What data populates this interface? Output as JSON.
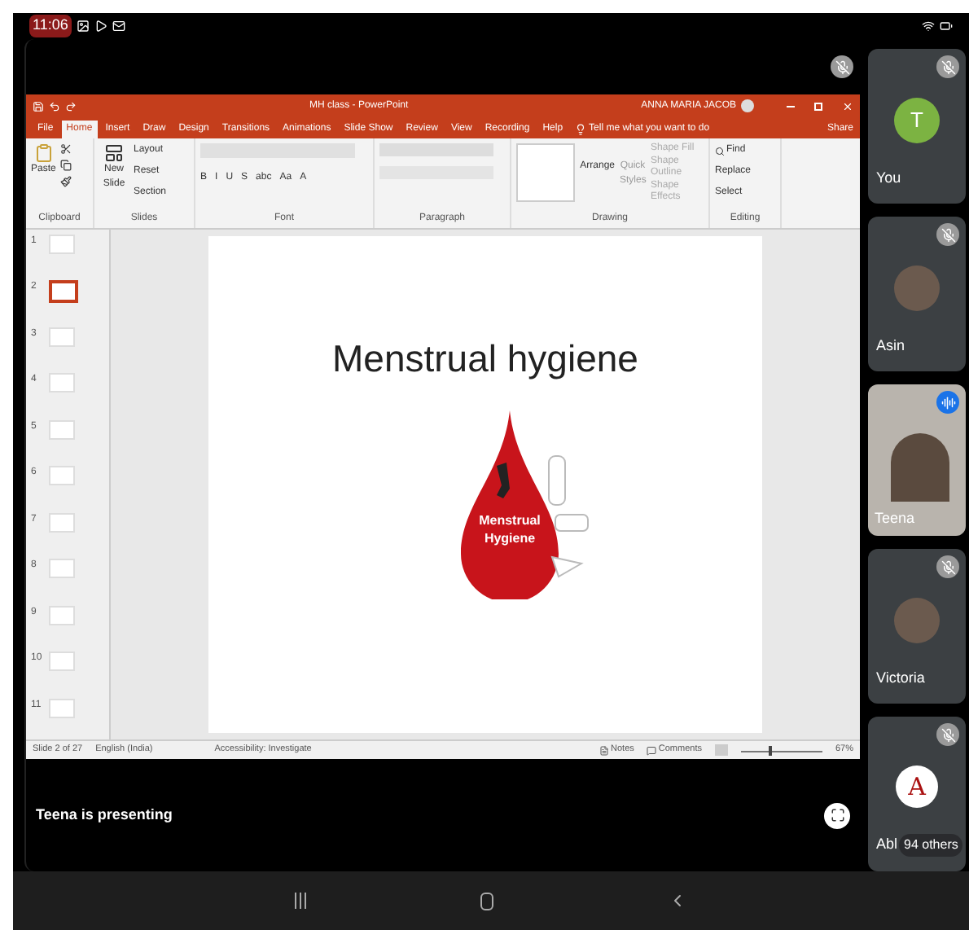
{
  "status_bar": {
    "time": "11:06"
  },
  "powerpoint": {
    "title": "MH class - PowerPoint",
    "user": "ANNA MARIA JACOB",
    "tabs": [
      {
        "label": "File",
        "selected": false
      },
      {
        "label": "Home",
        "selected": true
      },
      {
        "label": "Insert",
        "selected": false
      },
      {
        "label": "Draw",
        "selected": false
      },
      {
        "label": "Design",
        "selected": false
      },
      {
        "label": "Transitions",
        "selected": false
      },
      {
        "label": "Animations",
        "selected": false
      },
      {
        "label": "Slide Show",
        "selected": false
      },
      {
        "label": "Review",
        "selected": false
      },
      {
        "label": "View",
        "selected": false
      },
      {
        "label": "Recording",
        "selected": false
      },
      {
        "label": "Help",
        "selected": false
      }
    ],
    "tell_me": "Tell me what you want to do",
    "share": "Share",
    "ribbon": {
      "clipboard": {
        "paste": "Paste",
        "label": "Clipboard"
      },
      "slides": {
        "new_slide": "New Slide",
        "layout": "Layout",
        "reset": "Reset",
        "section": "Section",
        "label": "Slides"
      },
      "font": {
        "buttons": [
          "B",
          "I",
          "U",
          "S",
          "abc",
          "Aa",
          "A"
        ],
        "label": "Font"
      },
      "paragraph": {
        "label": "Paragraph"
      },
      "drawing": {
        "arrange": "Arrange",
        "quick_styles": "Quick Styles",
        "shape_fill": "Shape Fill",
        "shape_outline": "Shape Outline",
        "shape_effects": "Shape Effects",
        "label": "Drawing"
      },
      "editing": {
        "find": "Find",
        "replace": "Replace",
        "select": "Select",
        "label": "Editing"
      }
    },
    "slides": [
      {
        "number": "1",
        "selected": false
      },
      {
        "number": "2",
        "selected": true
      },
      {
        "number": "3",
        "selected": false
      },
      {
        "number": "4",
        "selected": false
      },
      {
        "number": "5",
        "selected": false
      },
      {
        "number": "6",
        "selected": false
      },
      {
        "number": "7",
        "selected": false
      },
      {
        "number": "8",
        "selected": false
      },
      {
        "number": "9",
        "selected": false
      },
      {
        "number": "10",
        "selected": false
      },
      {
        "number": "11",
        "selected": false
      }
    ],
    "slide": {
      "title": "Menstrual hygiene",
      "logo_line_1": "Menstrual",
      "logo_line_2": "Hygiene"
    },
    "status": {
      "slide_count": "Slide 2 of 27",
      "language": "English (India)",
      "accessibility": "Accessibility: Investigate",
      "notes": "Notes",
      "comments": "Comments",
      "zoom": "67%",
      "zoom_slider": {
        "level": 0.35
      }
    }
  },
  "presenting": "Teena is presenting",
  "participants": [
    {
      "name": "You",
      "kind": "initial",
      "initial": "T",
      "muted": true
    },
    {
      "name": "Asin",
      "kind": "photo",
      "muted": true
    },
    {
      "name": "Teena",
      "kind": "video",
      "muted": false
    },
    {
      "name": "Victoria",
      "kind": "photo",
      "muted": true
    },
    {
      "name": "Abl",
      "kind": "logo",
      "initial": "A",
      "muted": true,
      "others": "94 others"
    }
  ]
}
